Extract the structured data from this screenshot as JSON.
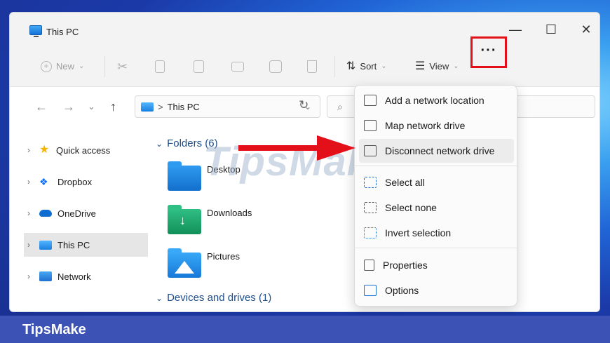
{
  "window": {
    "title": "This PC"
  },
  "controls": {
    "minimize": "—",
    "maximize": "☐",
    "close": "✕"
  },
  "toolbar": {
    "new_label": "New",
    "sort_label": "Sort",
    "view_label": "View",
    "more_label": "···"
  },
  "nav": {
    "back": "←",
    "forward": "→",
    "recent": "⌄",
    "up": "↑",
    "address_sep": ">",
    "address_text": "This PC",
    "address_chevron": "⌄",
    "refresh": "↻",
    "search_icon": "⌕"
  },
  "sidebar": {
    "items": [
      {
        "label": "Quick access",
        "icon": "star-icon"
      },
      {
        "label": "Dropbox",
        "icon": "dropbox-icon"
      },
      {
        "label": "OneDrive",
        "icon": "cloud-icon"
      },
      {
        "label": "This PC",
        "icon": "computer-icon",
        "selected": true
      },
      {
        "label": "Network",
        "icon": "network-icon"
      }
    ]
  },
  "main": {
    "folders_header": "Folders (6)",
    "folders": [
      {
        "label": "Desktop",
        "color": "#1e88e5"
      },
      {
        "label": "Downloads",
        "color": "#1aa36b"
      },
      {
        "label": "Pictures",
        "color": "#2196f3"
      }
    ],
    "devices_header": "Devices and drives (1)"
  },
  "menu": {
    "items": [
      {
        "label": "Add a network location",
        "icon": "network-location-icon"
      },
      {
        "label": "Map network drive",
        "icon": "map-drive-icon"
      },
      {
        "label": "Disconnect network drive",
        "icon": "disconnect-drive-icon"
      },
      {
        "label": "Select all",
        "icon": "select-all-icon"
      },
      {
        "label": "Select none",
        "icon": "select-none-icon"
      },
      {
        "label": "Invert selection",
        "icon": "invert-selection-icon"
      },
      {
        "label": "Properties",
        "icon": "properties-icon"
      },
      {
        "label": "Options",
        "icon": "options-icon"
      }
    ]
  },
  "watermark": "TipsMake",
  "footer": {
    "brand": "TipsMake"
  },
  "colors": {
    "highlight": "#e3101a",
    "footer": "#3d52b5",
    "accent": "#1f4f8a"
  }
}
